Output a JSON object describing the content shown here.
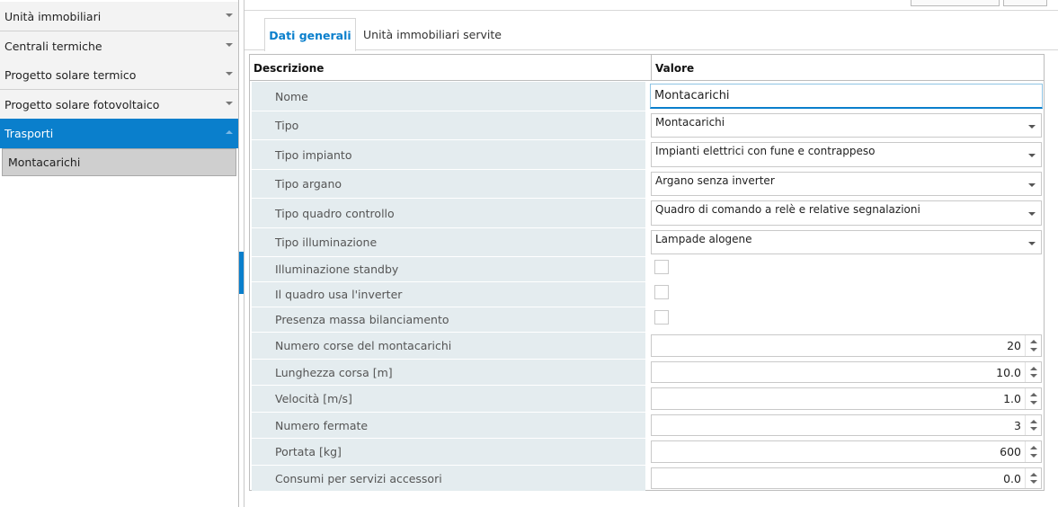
{
  "sidebar": {
    "items": [
      {
        "label": "Unità immobiliari"
      },
      {
        "label": "Centrali termiche"
      },
      {
        "label": "Progetto solare termico"
      },
      {
        "label": "Progetto solare fotovoltaico"
      },
      {
        "label": "Trasporti"
      }
    ],
    "sub_items": [
      {
        "label": "Montacarichi"
      }
    ]
  },
  "tabs": [
    {
      "label": "Dati generali"
    },
    {
      "label": "Unità immobiliari servite"
    }
  ],
  "grid": {
    "col_description": "Descrizione",
    "col_value": "Valore",
    "rows": {
      "nome": {
        "label": "Nome",
        "value": "Montacarichi"
      },
      "tipo": {
        "label": "Tipo",
        "value": "Montacarichi"
      },
      "tipo_impianto": {
        "label": "Tipo impianto",
        "value": "Impianti elettrici con fune e contrappeso"
      },
      "tipo_argano": {
        "label": "Tipo argano",
        "value": "Argano senza inverter"
      },
      "tipo_quadro": {
        "label": "Tipo quadro controllo",
        "value": "Quadro di comando a relè e relative segnalazioni"
      },
      "tipo_illuminazione": {
        "label": "Tipo illuminazione",
        "value": "Lampade alogene"
      },
      "illuminazione_standby": {
        "label": "Illuminazione standby",
        "checked": false
      },
      "quadro_inverter": {
        "label": "Il quadro usa l'inverter",
        "checked": false
      },
      "massa_bilanciamento": {
        "label": "Presenza massa bilanciamento",
        "checked": false
      },
      "numero_corse": {
        "label": "Numero corse del montacarichi",
        "value": "20"
      },
      "lunghezza_corsa": {
        "label": "Lunghezza corsa [m]",
        "value": "10.0"
      },
      "velocita": {
        "label": "Velocità [m/s]",
        "value": "1.0"
      },
      "numero_fermate": {
        "label": "Numero fermate",
        "value": "3"
      },
      "portata": {
        "label": "Portata [kg]",
        "value": "600"
      },
      "consumi": {
        "label": "Consumi per servizi accessori",
        "value": "0.0"
      }
    }
  },
  "colors": {
    "accent": "#0a7fcc",
    "label_background": "#e4ecef",
    "selected_sub_item": "#cfcfcf"
  }
}
